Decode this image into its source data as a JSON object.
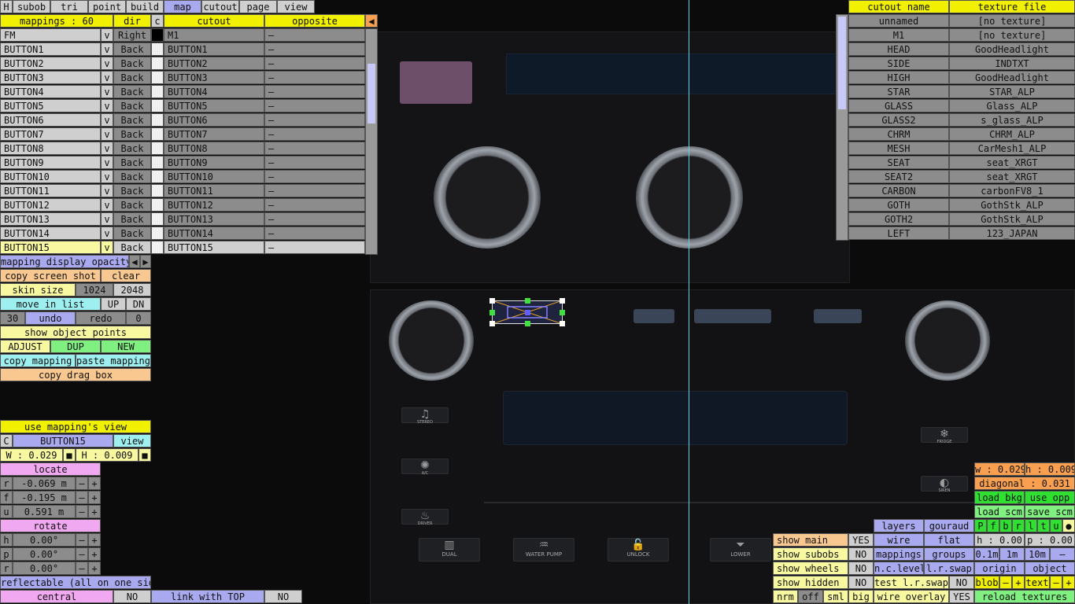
{
  "tabs": [
    "H",
    "subob",
    "tri",
    "point",
    "build",
    "map",
    "cutout",
    "page",
    "view"
  ],
  "active_tab": "map",
  "mappings": {
    "header": {
      "count": "mappings : 60",
      "dir": "dir",
      "c": "c",
      "cutout": "cutout",
      "opposite": "opposite",
      "arrow": "◀"
    },
    "rows": [
      {
        "name": "FM",
        "v": "v",
        "dir": "Right",
        "cutout": "M1",
        "opp": "–"
      },
      {
        "name": "BUTTON1",
        "v": "v",
        "dir": "Back",
        "cutout": "BUTTON1",
        "opp": "–"
      },
      {
        "name": "BUTTON2",
        "v": "v",
        "dir": "Back",
        "cutout": "BUTTON2",
        "opp": "–"
      },
      {
        "name": "BUTTON3",
        "v": "v",
        "dir": "Back",
        "cutout": "BUTTON3",
        "opp": "–"
      },
      {
        "name": "BUTTON4",
        "v": "v",
        "dir": "Back",
        "cutout": "BUTTON4",
        "opp": "–"
      },
      {
        "name": "BUTTON5",
        "v": "v",
        "dir": "Back",
        "cutout": "BUTTON5",
        "opp": "–"
      },
      {
        "name": "BUTTON6",
        "v": "v",
        "dir": "Back",
        "cutout": "BUTTON6",
        "opp": "–"
      },
      {
        "name": "BUTTON7",
        "v": "v",
        "dir": "Back",
        "cutout": "BUTTON7",
        "opp": "–"
      },
      {
        "name": "BUTTON8",
        "v": "v",
        "dir": "Back",
        "cutout": "BUTTON8",
        "opp": "–"
      },
      {
        "name": "BUTTON9",
        "v": "v",
        "dir": "Back",
        "cutout": "BUTTON9",
        "opp": "–"
      },
      {
        "name": "BUTTON10",
        "v": "v",
        "dir": "Back",
        "cutout": "BUTTON10",
        "opp": "–"
      },
      {
        "name": "BUTTON11",
        "v": "v",
        "dir": "Back",
        "cutout": "BUTTON11",
        "opp": "–"
      },
      {
        "name": "BUTTON12",
        "v": "v",
        "dir": "Back",
        "cutout": "BUTTON12",
        "opp": "–"
      },
      {
        "name": "BUTTON13",
        "v": "v",
        "dir": "Back",
        "cutout": "BUTTON13",
        "opp": "–"
      },
      {
        "name": "BUTTON14",
        "v": "v",
        "dir": "Back",
        "cutout": "BUTTON14",
        "opp": "–"
      },
      {
        "name": "BUTTON15",
        "v": "v",
        "dir": "Back",
        "cutout": "BUTTON15",
        "opp": "–"
      }
    ]
  },
  "cutouts": {
    "header": {
      "name": "cutout name",
      "tex": "texture file"
    },
    "rows": [
      {
        "name": "unnamed",
        "tex": "[no texture]"
      },
      {
        "name": "M1",
        "tex": "[no texture]"
      },
      {
        "name": "HEAD",
        "tex": "GoodHeadlight"
      },
      {
        "name": "SIDE",
        "tex": "INDTXT"
      },
      {
        "name": "HIGH",
        "tex": "GoodHeadlight"
      },
      {
        "name": "STAR",
        "tex": "STAR_ALP"
      },
      {
        "name": "GLASS",
        "tex": "Glass_ALP"
      },
      {
        "name": "GLASS2",
        "tex": "s_glass_ALP"
      },
      {
        "name": "CHRM",
        "tex": "CHRM_ALP"
      },
      {
        "name": "MESH",
        "tex": "CarMesh1_ALP"
      },
      {
        "name": "SEAT",
        "tex": "seat_XRGT"
      },
      {
        "name": "SEAT2",
        "tex": "seat_XRGT"
      },
      {
        "name": "CARBON",
        "tex": "carbonFV8_1"
      },
      {
        "name": "GOTH",
        "tex": "GothStk_ALP"
      },
      {
        "name": "GOTH2",
        "tex": "GothStk_ALP"
      },
      {
        "name": "LEFT",
        "tex": "123_JAPAN"
      }
    ]
  },
  "left": {
    "opacity": "mapping display opacity",
    "prev": "◀",
    "next": "▶",
    "copy_screen": "copy screen shot",
    "clear": "clear",
    "skin_size": "skin size",
    "s1024": "1024",
    "s2048": "2048",
    "move_list": "move in list",
    "up": "UP",
    "dn": "DN",
    "n30": "30",
    "undo": "undo",
    "redo": "redo",
    "n0": "0",
    "show_points": "show object points",
    "adjust": "ADJUST",
    "dup": "DUP",
    "new": "NEW",
    "copy_map": "copy mapping",
    "paste_map": "paste mapping",
    "copy_drag": "copy drag box",
    "use_view": "use mapping's view",
    "c": "C",
    "sel_name": "BUTTON15",
    "view": "view",
    "w": "W : 0.029",
    "h": "H : 0.009",
    "sq": "■",
    "locate": "locate",
    "r": "r",
    "rv": "-0.069 m",
    "f": "f",
    "fv": "-0.195 m",
    "u": "u",
    "uv": "0.591 m",
    "minus": "–",
    "plus": "+",
    "rotate": "rotate",
    "hh": "h",
    "hv": "0.00°",
    "pp": "p",
    "pv": "0.00°",
    "rr": "r",
    "rv2": "0.00°",
    "reflectable": "reflectable (all on one side)",
    "central": "central",
    "no": "NO",
    "link_top": "link with TOP"
  },
  "right": {
    "w": "w : 0.029",
    "h": "h : 0.009",
    "diag": "diagonal : 0.031",
    "load_bkg": "load bkg",
    "use_opp": "use opp",
    "load_scm": "load scm",
    "save_scm": "save scm",
    "views": [
      "P",
      "f",
      "b",
      "r",
      "l",
      "t",
      "u",
      "●"
    ],
    "layers": "layers",
    "gouraud": "gouraud",
    "h0": "h : 0.00",
    "p0": "p : 0.00",
    "wire": "wire",
    "flat": "flat",
    "m01": "0.1m",
    "m1": "1m",
    "m10": "10m",
    "minus": "–",
    "mappings": "mappings",
    "groups": "groups",
    "nc": "n.c.level",
    "lr": "l.r.swap",
    "origin": "origin",
    "object": "object",
    "test_lr": "test l.r.swap",
    "no": "NO",
    "blob": "blob",
    "text": "text",
    "plus": "+",
    "wire_ov": "wire overlay",
    "yes": "YES",
    "reload": "reload textures",
    "show_main": "show main",
    "show_subobs": "show subobs",
    "show_wheels": "show wheels",
    "show_hidden": "show hidden",
    "nrm": "nrm",
    "off": "off",
    "sml": "sml",
    "big": "big"
  },
  "scene_labels": {
    "stereo": "STEREO",
    "ac": "A/C",
    "driver": "DRIVER",
    "dual": "DUAL",
    "water": "WATER PUMP",
    "unlock": "UNLOCK",
    "lower": "LOWER",
    "fridge": "FRIDGE",
    "siren": "SIREN"
  },
  "scene_icons": {
    "stereo": "♫",
    "ac": "✺",
    "driver": "♨",
    "dual": "▥",
    "water": "♒",
    "unlock": "🔓",
    "lower": "⏷",
    "fridge": "❄",
    "siren": "◐"
  }
}
